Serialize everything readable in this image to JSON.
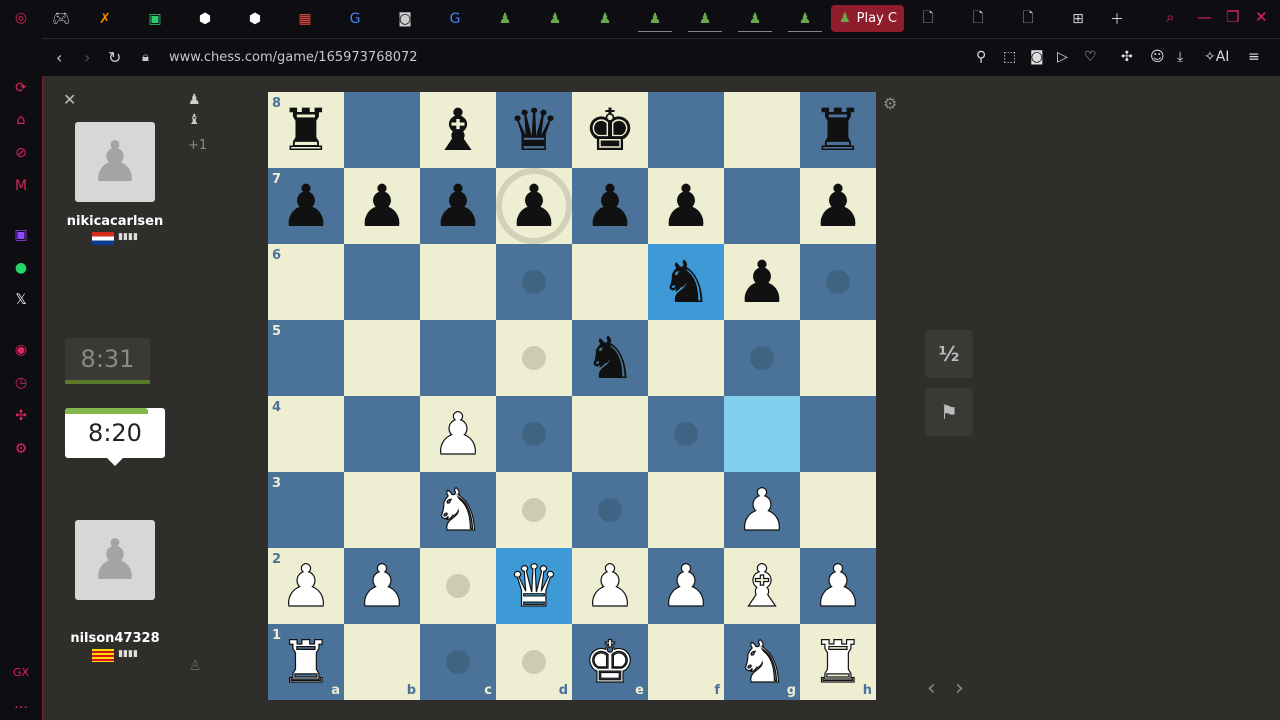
{
  "browser": {
    "active_tab_label": "Play C",
    "url": "www.chess.com/game/165973768072",
    "ai_label": "AI"
  },
  "players": {
    "top": {
      "name": "nikicacarlsen",
      "clock": "8:31",
      "captured_plus": "+1",
      "country": "Croatia"
    },
    "bottom": {
      "name": "nilson47328",
      "clock": "8:20",
      "country": "Catalonia"
    }
  },
  "board": {
    "ranks": [
      "8",
      "7",
      "6",
      "5",
      "4",
      "3",
      "2",
      "1"
    ],
    "files": [
      "a",
      "b",
      "c",
      "d",
      "e",
      "f",
      "g",
      "h"
    ],
    "position": [
      [
        "r",
        "",
        "b",
        "q",
        "k",
        "",
        "",
        "r"
      ],
      [
        "p",
        "p",
        "p",
        "p",
        "p",
        "p",
        "",
        "p"
      ],
      [
        "",
        "",
        "",
        "",
        "",
        "n",
        "p",
        ""
      ],
      [
        "",
        "",
        "",
        "",
        "n",
        "",
        "",
        ""
      ],
      [
        "",
        "",
        "P",
        "",
        "",
        "",
        "",
        ""
      ],
      [
        "",
        "",
        "N",
        "",
        "",
        "",
        "P",
        ""
      ],
      [
        "P",
        "P",
        "",
        "Q",
        "P",
        "P",
        "B",
        "P"
      ],
      [
        "R",
        "",
        "",
        "",
        "K",
        "",
        "N",
        "R"
      ]
    ],
    "highlight_squares": [
      "f6",
      "d2"
    ],
    "last_move_squares": [
      "g4"
    ],
    "move_hint_dots": [
      "d6",
      "h6",
      "d5",
      "g5",
      "d4",
      "f4",
      "d3",
      "e3",
      "c2",
      "c1",
      "d1"
    ],
    "ring_squares": [
      "d7"
    ]
  },
  "actions": {
    "draw_label": "½",
    "resign_icon": "flag-icon"
  }
}
